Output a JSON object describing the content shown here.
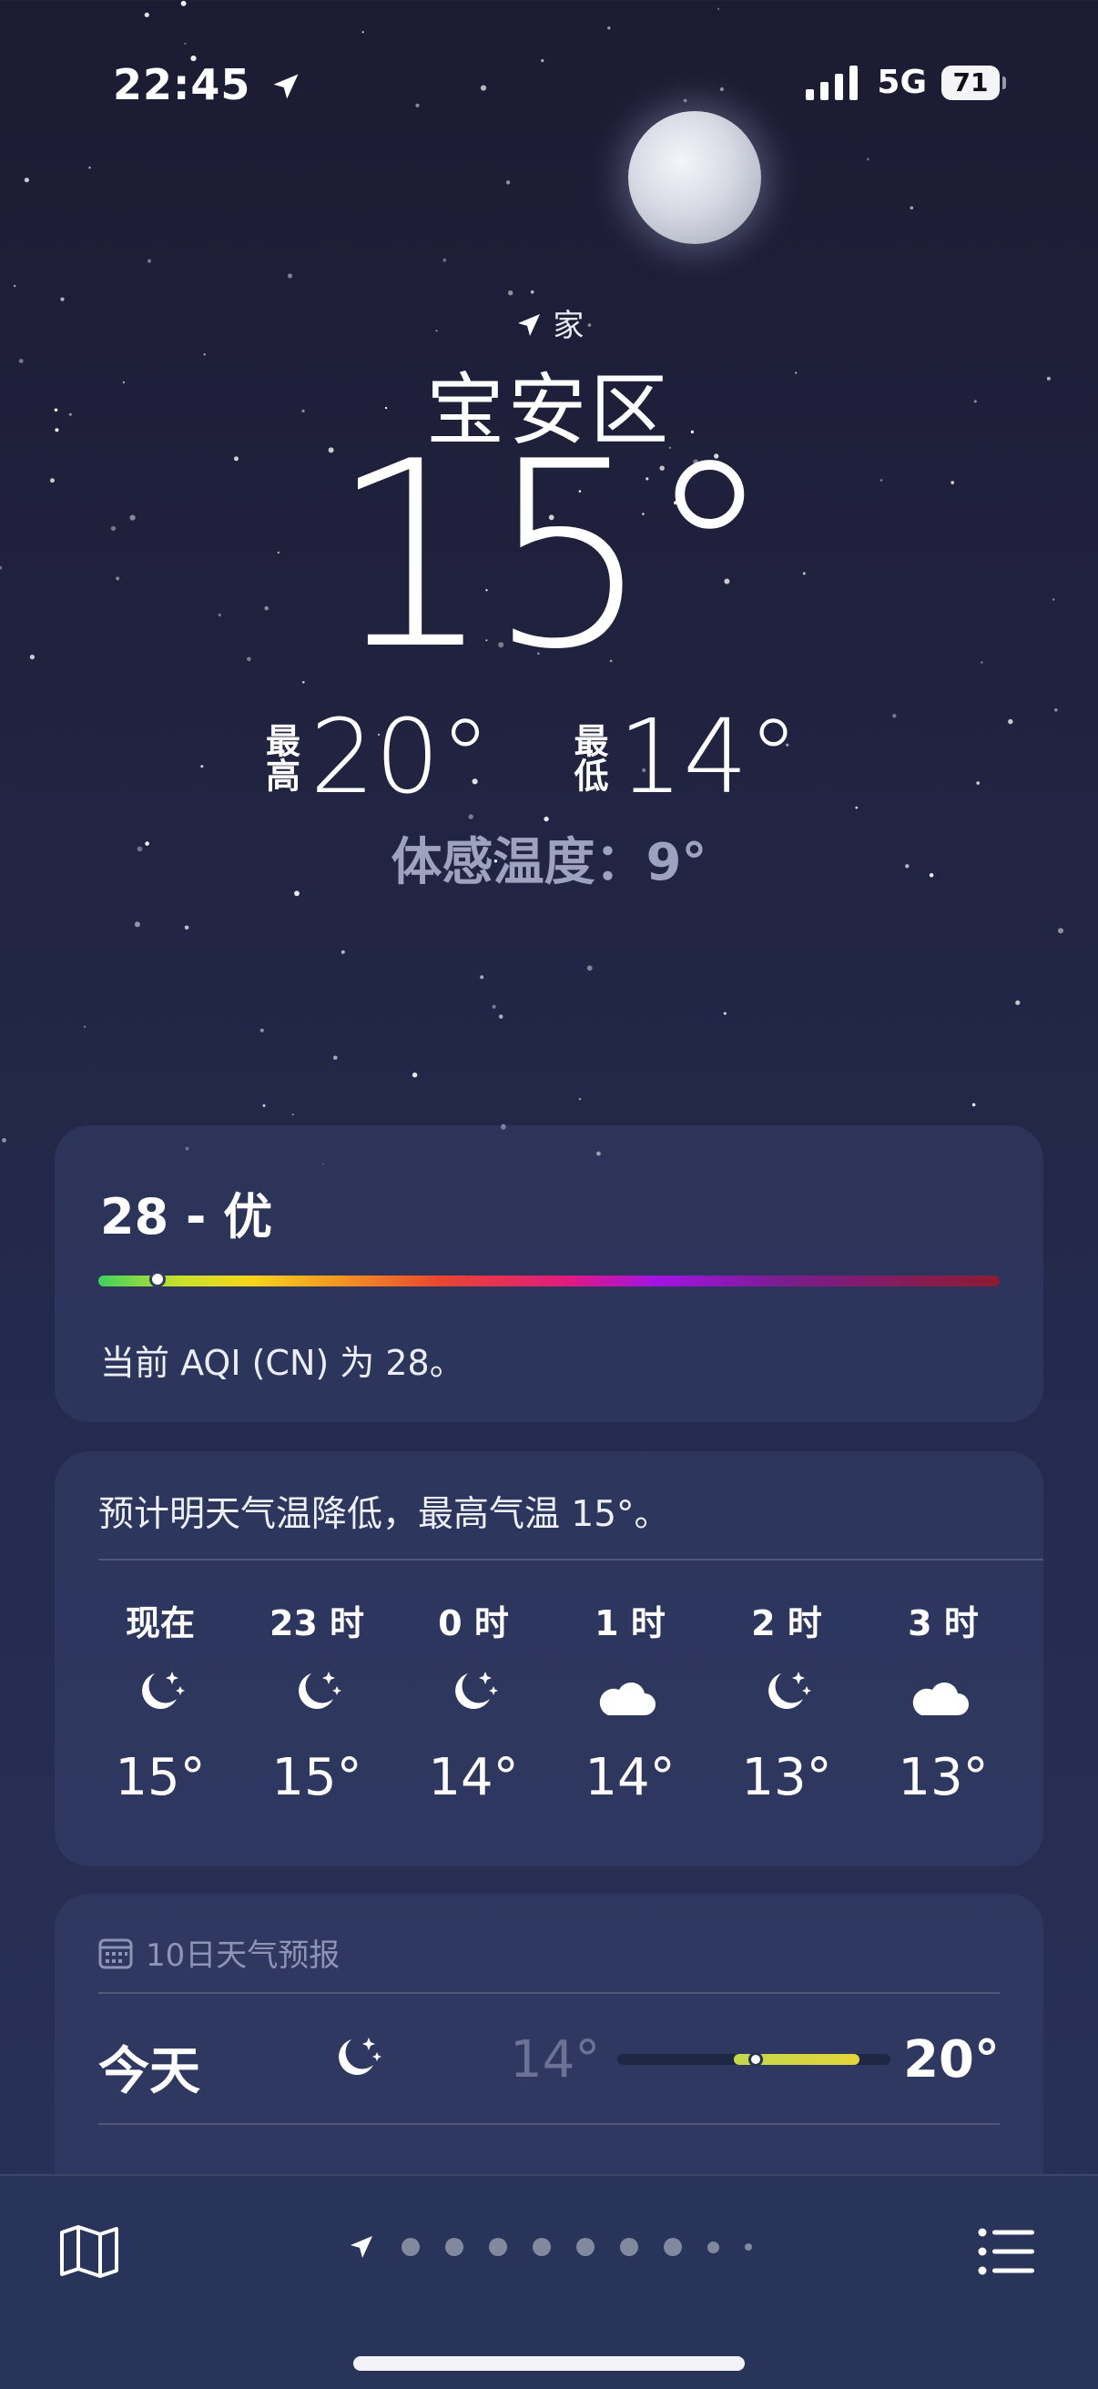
{
  "status_bar": {
    "time": "22:45",
    "network": "5G",
    "battery": "71"
  },
  "location": {
    "label": "家",
    "city": "宝安区"
  },
  "current": {
    "temperature": "15°",
    "high_label": "最高",
    "high": "20°",
    "low_label": "最低",
    "low": "14°",
    "feels_like": "体感温度：9°"
  },
  "aqi": {
    "title": "28 - 优",
    "value": 28,
    "description": "当前 AQI (CN) 为 28。"
  },
  "hourly": {
    "summary": "预计明天气温降低，最高气温 15°。",
    "hours": [
      {
        "label": "现在",
        "icon": "moon-stars-icon",
        "temp": "15°"
      },
      {
        "label": "23 时",
        "icon": "moon-stars-icon",
        "temp": "15°"
      },
      {
        "label": "0 时",
        "icon": "moon-stars-icon",
        "temp": "14°"
      },
      {
        "label": "1 时",
        "icon": "cloud-moon-icon",
        "temp": "14°"
      },
      {
        "label": "2 时",
        "icon": "moon-stars-icon",
        "temp": "13°"
      },
      {
        "label": "3 时",
        "icon": "cloud-moon-icon",
        "temp": "13°"
      }
    ]
  },
  "forecast": {
    "title": "10日天气预报",
    "icon": "calendar-icon",
    "days": [
      {
        "day": "今天",
        "icon": "moon-stars-icon",
        "low": "14°",
        "high": "20°"
      }
    ]
  },
  "bottom_bar": {
    "map_icon": "map-icon",
    "list_icon": "list-icon",
    "location_dot_icon": "location-arrow-icon",
    "page_count": 9
  },
  "colors": {
    "background_top": "#1c1b33",
    "background_bottom": "#28325a",
    "card": "#3a4470",
    "forecast_bar": "#e5d53a"
  }
}
